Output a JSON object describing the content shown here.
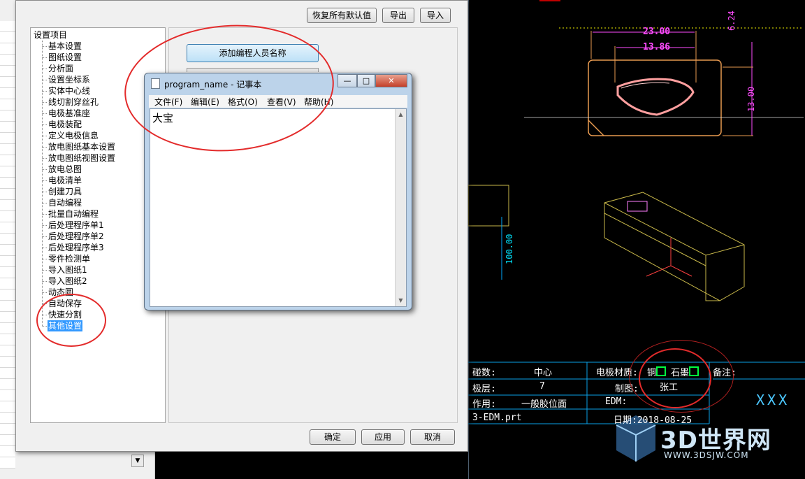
{
  "settings_dialog": {
    "toolbar": {
      "restore_defaults": "恢复所有默认值",
      "export": "导出",
      "import": "导入"
    },
    "tree": {
      "root": "设置项目",
      "items": [
        "基本设置",
        "图纸设置",
        "分析面",
        "设置坐标系",
        "实体中心线",
        "线切割穿丝孔",
        "电极基准座",
        "电极装配",
        "定义电极信息",
        "放电图纸基本设置",
        "放电图纸视图设置",
        "放电总图",
        "电极清单",
        "创建刀具",
        "自动编程",
        "批量自动编程",
        "后处理程序单1",
        "后处理程序单2",
        "后处理程序单3",
        "零件检测单",
        "导入图纸1",
        "导入图纸2",
        "动态圆",
        "自动保存",
        "快速分割",
        "其他设置"
      ],
      "selected": "其他设置"
    },
    "add_programmer_button": "添加编程人员名称",
    "footer": {
      "ok": "确定",
      "apply": "应用",
      "cancel": "取消"
    }
  },
  "notepad": {
    "title": "program_name - 记事本",
    "menu": [
      "文件(F)",
      "编辑(E)",
      "格式(O)",
      "查看(V)",
      "帮助(H)"
    ],
    "content": "大宝"
  },
  "cad": {
    "dim_width": "23.00",
    "dim_inner": "13.86",
    "dim_right_top": "6.24",
    "dim_right": "13.00",
    "dim_vertical": "100.00",
    "title_block": {
      "r1c1": "碰数:",
      "r1c2": "中心",
      "r1c3": "电极材质:",
      "copper": "铜",
      "graphite": "石墨",
      "r1c4": "备注:",
      "r2c1": "极层:",
      "r2c2": "7",
      "r2c3": "制图:",
      "r2c4": "张工",
      "r3c1": "作用:",
      "r3c2": "一般胶位面",
      "r3c3": "EDM:",
      "r4c1": "3-EDM.prt",
      "r4c3": "日期:2018-08-25",
      "xxx": "XXX"
    }
  },
  "watermark": {
    "name": "3D世界网",
    "url": "WWW.3DSJW.COM"
  }
}
